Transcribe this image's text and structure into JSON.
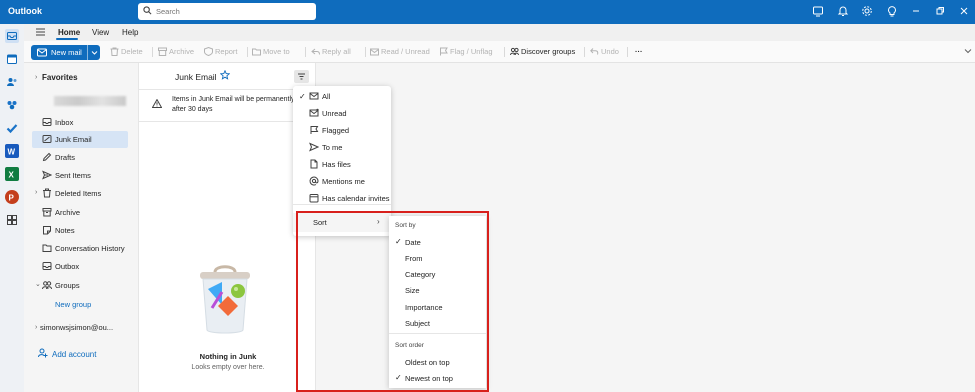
{
  "app": {
    "title": "Outlook"
  },
  "search": {
    "placeholder": "Search"
  },
  "ribbon_tabs": [
    {
      "label": "Home",
      "active": true
    },
    {
      "label": "View"
    },
    {
      "label": "Help"
    }
  ],
  "ribbon": {
    "new_mail": "New mail",
    "delete": "Delete",
    "archive": "Archive",
    "report": "Report",
    "move_to": "Move to",
    "reply_all": "Reply all",
    "read_unread": "Read / Unread",
    "flag_unflag": "Flag / Unflag",
    "discover_groups": "Discover groups",
    "undo": "Undo",
    "more": "···"
  },
  "folders": {
    "favorites": "Favorites",
    "items": [
      {
        "label": "Inbox",
        "icon": "inbox-icon"
      },
      {
        "label": "Junk Email",
        "icon": "junk-icon",
        "selected": true
      },
      {
        "label": "Drafts",
        "icon": "pencil-icon"
      },
      {
        "label": "Sent Items",
        "icon": "send-icon"
      },
      {
        "label": "Deleted Items",
        "icon": "trash-icon",
        "expandable": true
      },
      {
        "label": "Archive",
        "icon": "archive-icon"
      },
      {
        "label": "Notes",
        "icon": "note-icon"
      },
      {
        "label": "Conversation History",
        "icon": "folder-icon"
      },
      {
        "label": "Outbox",
        "icon": "outbox-icon"
      },
      {
        "label": "Groups",
        "icon": "groups-icon",
        "expandable": true
      }
    ],
    "new_group": "New group",
    "account": "simonwsjsimon@ou...",
    "add_account": "Add account"
  },
  "list": {
    "title": "Junk Email",
    "notice": "Items in Junk Email will be permanently deleted after 30 days",
    "empty_title": "Nothing in Junk",
    "empty_sub": "Looks empty over here."
  },
  "filter_menu": {
    "items": [
      {
        "label": "All",
        "checked": true,
        "icon": "mail-icon"
      },
      {
        "label": "Unread",
        "icon": "mail-unread-icon"
      },
      {
        "label": "Flagged",
        "icon": "flag-icon"
      },
      {
        "label": "To me",
        "icon": "send-icon"
      },
      {
        "label": "Has files",
        "icon": "attachment-icon"
      },
      {
        "label": "Mentions me",
        "icon": "at-icon"
      },
      {
        "label": "Has calendar invites",
        "icon": "calendar-icon"
      }
    ],
    "sort": "Sort"
  },
  "sort_menu": {
    "sort_by_header": "Sort by",
    "sort_by": [
      {
        "label": "Date",
        "checked": true
      },
      {
        "label": "From"
      },
      {
        "label": "Category"
      },
      {
        "label": "Size"
      },
      {
        "label": "Importance"
      },
      {
        "label": "Subject"
      }
    ],
    "sort_order_header": "Sort order",
    "sort_order": [
      {
        "label": "Oldest on top"
      },
      {
        "label": "Newest on top",
        "checked": true
      }
    ]
  },
  "colors": {
    "brand": "#0f6cbd",
    "highlight": "#d8201c",
    "selected": "#d6e4f5"
  }
}
